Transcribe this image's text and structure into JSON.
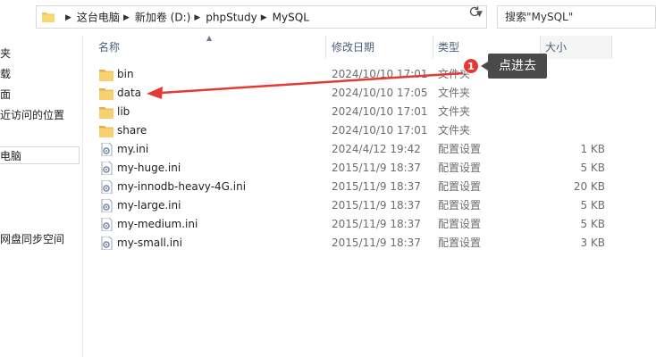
{
  "address": {
    "segments": [
      "这台电脑",
      "新加卷 (D:)",
      "phpStudy",
      "MySQL"
    ]
  },
  "search": {
    "placeholder": "搜索\"MySQL\""
  },
  "nav": {
    "items": [
      {
        "label": "夹"
      },
      {
        "label": "载"
      },
      {
        "label": "面"
      },
      {
        "label": "近访问的位置"
      },
      {
        "label": "电脑"
      },
      {
        "label": "网盘同步空间"
      }
    ]
  },
  "columns": {
    "name": "名称",
    "date": "修改日期",
    "type": "类型",
    "size": "大小"
  },
  "files": [
    {
      "name": "bin",
      "date": "2024/10/10 17:01",
      "type": "文件夹",
      "size": "",
      "icon": "folder-icon"
    },
    {
      "name": "data",
      "date": "2024/10/10 17:05",
      "type": "文件夹",
      "size": "",
      "icon": "folder-icon"
    },
    {
      "name": "lib",
      "date": "2024/10/10 17:01",
      "type": "文件夹",
      "size": "",
      "icon": "folder-icon"
    },
    {
      "name": "share",
      "date": "2024/10/10 17:01",
      "type": "文件夹",
      "size": "",
      "icon": "folder-icon"
    },
    {
      "name": "my.ini",
      "date": "2024/4/12 19:42",
      "type": "配置设置",
      "size": "1 KB",
      "icon": "ini-file-icon"
    },
    {
      "name": "my-huge.ini",
      "date": "2015/11/9 18:37",
      "type": "配置设置",
      "size": "5 KB",
      "icon": "ini-file-icon"
    },
    {
      "name": "my-innodb-heavy-4G.ini",
      "date": "2015/11/9 18:37",
      "type": "配置设置",
      "size": "20 KB",
      "icon": "ini-file-icon"
    },
    {
      "name": "my-large.ini",
      "date": "2015/11/9 18:37",
      "type": "配置设置",
      "size": "5 KB",
      "icon": "ini-file-icon"
    },
    {
      "name": "my-medium.ini",
      "date": "2015/11/9 18:37",
      "type": "配置设置",
      "size": "5 KB",
      "icon": "ini-file-icon"
    },
    {
      "name": "my-small.ini",
      "date": "2015/11/9 18:37",
      "type": "配置设置",
      "size": "3 KB",
      "icon": "ini-file-icon"
    }
  ],
  "annotation": {
    "badge": "1",
    "text": "点进去",
    "color": "#e53935"
  },
  "colors": {
    "folder": "#f2c55c",
    "accent_red": "#e53935",
    "header_text": "#4c607a"
  }
}
